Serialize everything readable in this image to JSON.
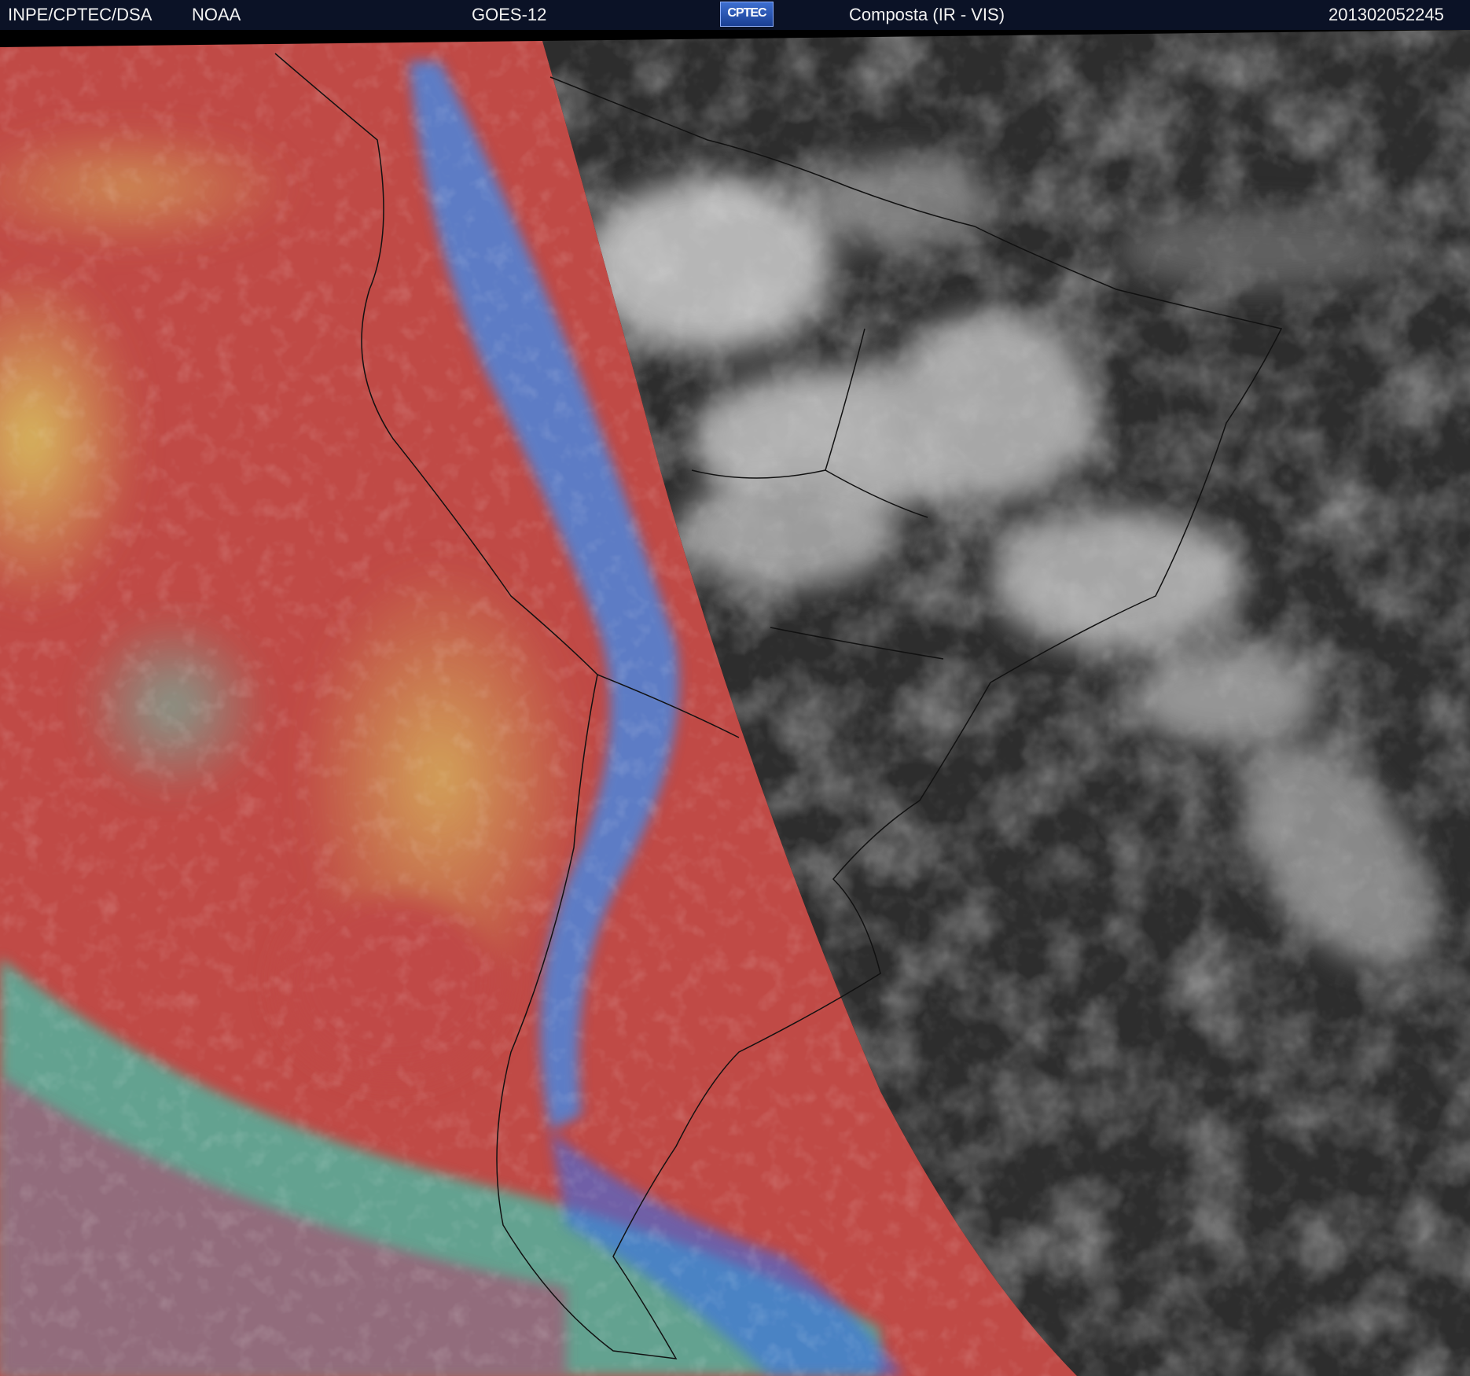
{
  "header": {
    "agency": "INPE/CPTEC/DSA",
    "partner": "NOAA",
    "satellite": "GOES-12",
    "logo_text": "CPTEC",
    "product": "Composta (IR - VIS)",
    "timestamp": "201302052245"
  },
  "colors": {
    "header_bg": "#0b1226",
    "ir_red": "#c04a44",
    "ir_yellow": "#c8c060",
    "ir_cyan": "#40d0c0",
    "ir_blue": "#3a8ae8",
    "vis_gray": "#2c2c2c",
    "vis_cloud": "#d8d8d8"
  }
}
